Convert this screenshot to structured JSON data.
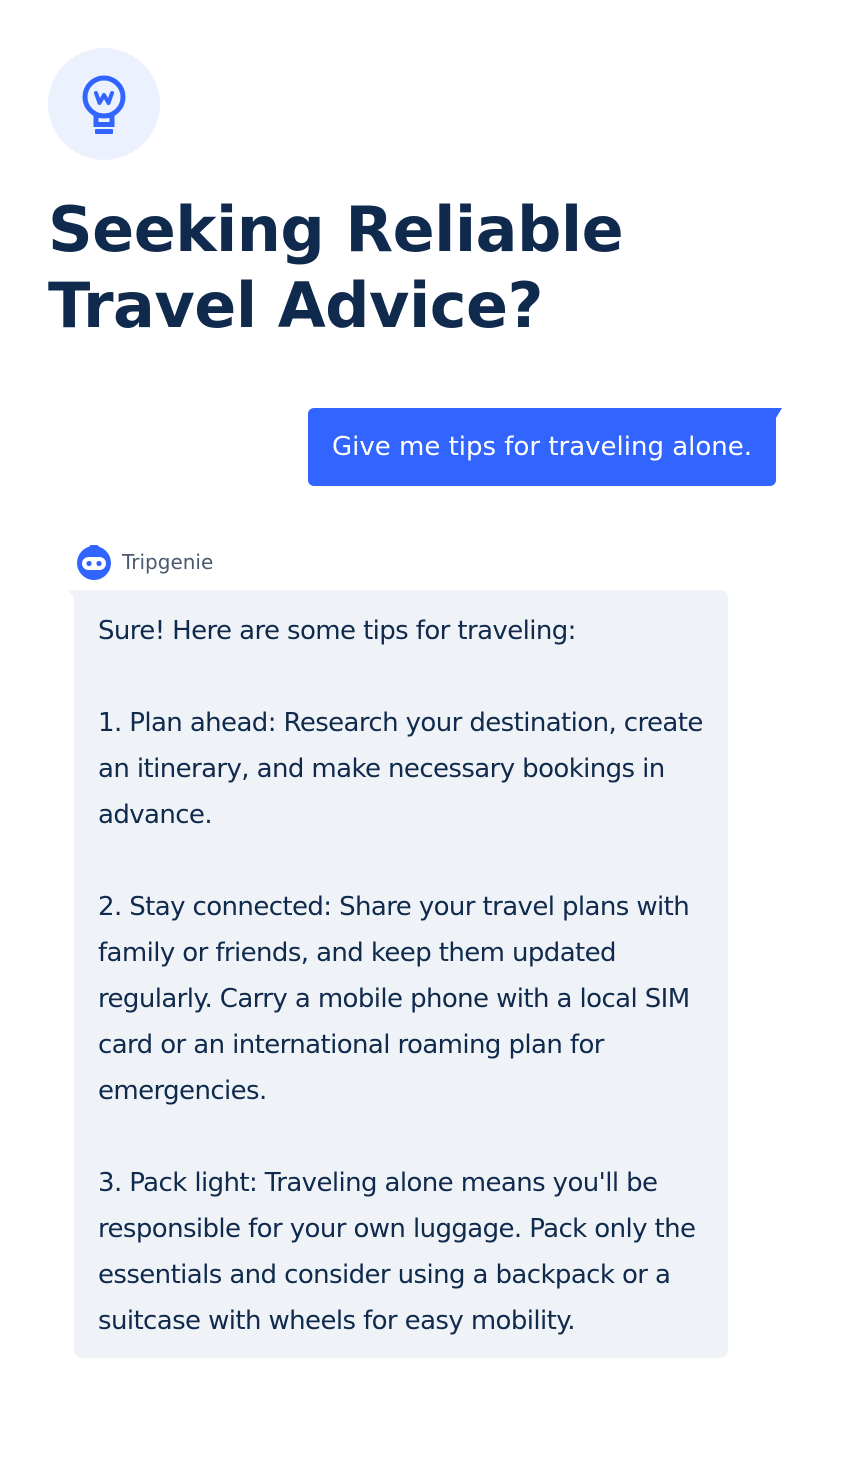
{
  "header": {
    "logo_icon": "lightbulb-w-icon",
    "title": "Seeking Reliable Travel Advice?"
  },
  "chat": {
    "user_message": "Give me tips for traveling alone.",
    "bot": {
      "name": "Tripgenie",
      "avatar_icon": "robot-icon",
      "message": "Sure! Here are some tips for traveling:\n\n1. Plan ahead: Research your destination, create an itinerary, and make necessary bookings in advance.\n\n2. Stay connected: Share your travel plans with family or friends, and keep them updated regularly. Carry a mobile phone with a local SIM card or an international roaming plan for emergencies.\n\n3. Pack light: Traveling alone means you'll be responsible for your own luggage. Pack only the essentials and consider using a backpack or a suitcase with wheels for easy mobility."
    }
  },
  "colors": {
    "accent": "#3264ff",
    "title_text": "#0f2a4d",
    "bot_bubble_bg": "#eff2f6",
    "logo_bg": "#ebf1fd"
  }
}
